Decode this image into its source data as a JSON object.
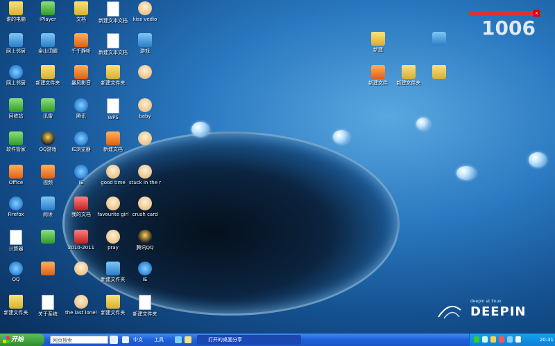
{
  "desktop_icons": [
    {
      "label": "谁的电脑",
      "icon": "folder-icon",
      "style": "folder"
    },
    {
      "label": "iPlayer",
      "icon": "media-player-icon",
      "style": "green"
    },
    {
      "label": "文档",
      "icon": "folder-icon",
      "style": "folder"
    },
    {
      "label": "新建文本文档",
      "icon": "document-icon",
      "style": "doc"
    },
    {
      "label": "kiss  vedio",
      "icon": "face-icon",
      "style": "face"
    },
    {
      "label": "网上邻居",
      "icon": "network-icon",
      "style": "app"
    },
    {
      "label": "金山词霸",
      "icon": "app-icon",
      "style": "app"
    },
    {
      "label": "千千静听",
      "icon": "music-icon",
      "style": "orange"
    },
    {
      "label": "新建文本文档",
      "icon": "document-icon",
      "style": "doc"
    },
    {
      "label": "游戏",
      "icon": "game-icon",
      "style": "app"
    },
    {
      "label": "网上邻居",
      "icon": "globe-icon",
      "style": "ie"
    },
    {
      "label": "新建文件夹",
      "icon": "folder-icon",
      "style": "folder"
    },
    {
      "label": "暴风影音",
      "icon": "video-icon",
      "style": "orange"
    },
    {
      "label": "新建文件夹",
      "icon": "folder-icon",
      "style": "folder"
    },
    {
      "label": "",
      "icon": "face-icon",
      "style": "face"
    },
    {
      "label": "回收站",
      "icon": "recycle-bin-icon",
      "style": "green"
    },
    {
      "label": "迅雷",
      "icon": "mail-icon",
      "style": "green"
    },
    {
      "label": "腾讯",
      "icon": "penguin-icon",
      "style": "ie"
    },
    {
      "label": "WPS",
      "icon": "document-icon",
      "style": "doc"
    },
    {
      "label": "baby",
      "icon": "face-icon",
      "style": "face"
    },
    {
      "label": "软件管家",
      "icon": "install-icon",
      "style": "green"
    },
    {
      "label": "QQ游戏",
      "icon": "penguin-icon",
      "style": "penguin"
    },
    {
      "label": "IE浏览器",
      "icon": "browser-icon",
      "style": "ie"
    },
    {
      "label": "新建文档",
      "icon": "edit-icon",
      "style": "orange"
    },
    {
      "label": "",
      "icon": "face-icon",
      "style": "face"
    },
    {
      "label": "Office",
      "icon": "office-icon",
      "style": "orange"
    },
    {
      "label": "视频",
      "icon": "video-icon",
      "style": "orange"
    },
    {
      "label": "IE",
      "icon": "browser-icon",
      "style": "ie"
    },
    {
      "label": "good time",
      "icon": "face-icon",
      "style": "face"
    },
    {
      "label": "stuck in the moment",
      "icon": "face-icon",
      "style": "face"
    },
    {
      "label": "Firefox",
      "icon": "firefox-icon",
      "style": "ie"
    },
    {
      "label": "阅读",
      "icon": "reader-icon",
      "style": "app"
    },
    {
      "label": "我的文档",
      "icon": "app-icon",
      "style": "red"
    },
    {
      "label": "favourite girl",
      "icon": "face-icon",
      "style": "face"
    },
    {
      "label": "crush card",
      "icon": "face-icon",
      "style": "face"
    },
    {
      "label": "计算器",
      "icon": "document-icon",
      "style": "doc"
    },
    {
      "label": "",
      "icon": "app-icon",
      "style": "green"
    },
    {
      "label": "2010-2011",
      "icon": "app-icon",
      "style": "red"
    },
    {
      "label": "pray",
      "icon": "face-icon",
      "style": "face"
    },
    {
      "label": "腾讯QQ",
      "icon": "penguin-icon",
      "style": "penguin"
    },
    {
      "label": "QQ",
      "icon": "browser-icon",
      "style": "ie"
    },
    {
      "label": "",
      "icon": "app-icon",
      "style": "orange"
    },
    {
      "label": "",
      "icon": "face-icon",
      "style": "face"
    },
    {
      "label": "新建文件夹",
      "icon": "app-icon",
      "style": "app"
    },
    {
      "label": "IE",
      "icon": "browser-icon",
      "style": "ie"
    },
    {
      "label": "新建文件夹",
      "icon": "folder-icon",
      "style": "folder"
    },
    {
      "label": "关于系统",
      "icon": "document-icon",
      "style": "doc"
    },
    {
      "label": "the last lonely girl",
      "icon": "face-icon",
      "style": "face"
    },
    {
      "label": "新建文件夹",
      "icon": "folder-icon",
      "style": "folder"
    },
    {
      "label": "新建文件夹",
      "icon": "document-icon",
      "style": "doc"
    },
    {
      "label": "新建",
      "icon": "folder-icon",
      "style": "folder"
    },
    {
      "label": "",
      "icon": "gem-icon",
      "style": "app"
    },
    {
      "label": "新建文件",
      "icon": "edit-icon",
      "style": "orange"
    },
    {
      "label": "新建文件夹",
      "icon": "folder-icon",
      "style": "folder"
    },
    {
      "label": "",
      "icon": "folder-icon",
      "style": "folder"
    }
  ],
  "logo": {
    "tagline": "deepin at linux",
    "text": "DEEPIN"
  },
  "watermark": {
    "text": "1006",
    "close": "x"
  },
  "taskbar": {
    "start_label": "开始",
    "search_placeholder": "网页搜索",
    "item1": "中文",
    "item2": "工具",
    "task_label": "打开的桌面分享",
    "clock": "20:31"
  },
  "colors": {
    "taskbar": "#1f5fd8",
    "start": "#2f8d2c",
    "tray": "#0c7fd6"
  }
}
